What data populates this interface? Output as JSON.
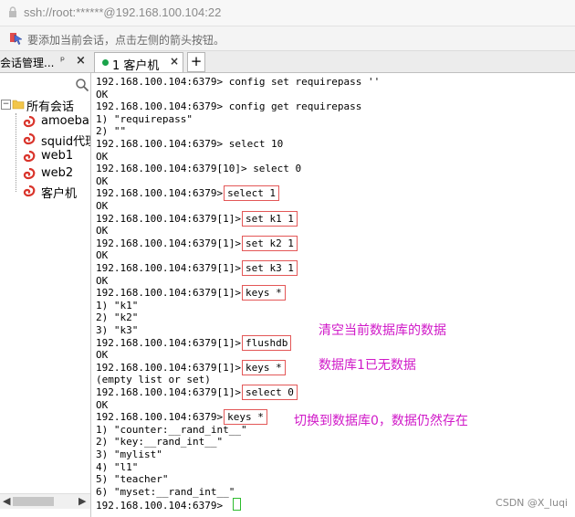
{
  "window": {
    "title": "ssh://root:******@192.168.100.104:22",
    "hint": "要添加当前会话，点击左侧的箭头按钮。"
  },
  "session_panel": {
    "title": "会话管理...",
    "pin_icon": "pin-icon",
    "close_icon": "close-icon",
    "root": "所有会话",
    "items": [
      "amoeba",
      "squid代理",
      "web1",
      "web2",
      "客户机"
    ]
  },
  "tabs": [
    {
      "label": "1 客户机",
      "status_color": "#19a34a"
    }
  ],
  "add_tab_label": "+",
  "terminal": {
    "lines": [
      {
        "prompt": "192.168.100.104:6379> ",
        "cmd": "config set requirepass ''",
        "boxed": false
      },
      {
        "text": "OK"
      },
      {
        "prompt": "192.168.100.104:6379> ",
        "cmd": "config get requirepass",
        "boxed": false
      },
      {
        "text": "1) \"requirepass\""
      },
      {
        "text": "2) \"\""
      },
      {
        "prompt": "192.168.100.104:6379> ",
        "cmd": "select 10",
        "boxed": false
      },
      {
        "text": "OK"
      },
      {
        "prompt": "192.168.100.104:6379[10]> ",
        "cmd": "select 0",
        "boxed": false
      },
      {
        "text": "OK"
      },
      {
        "prompt": "192.168.100.104:6379>",
        "cmd": "select 1",
        "boxed": true
      },
      {
        "text": "OK"
      },
      {
        "prompt": "192.168.100.104:6379[1]>",
        "cmd": "set k1 1",
        "boxed": true
      },
      {
        "text": "OK"
      },
      {
        "prompt": "192.168.100.104:6379[1]>",
        "cmd": "set k2 1",
        "boxed": true
      },
      {
        "text": "OK"
      },
      {
        "prompt": "192.168.100.104:6379[1]>",
        "cmd": "set k3 1",
        "boxed": true
      },
      {
        "text": "OK"
      },
      {
        "prompt": "192.168.100.104:6379[1]>",
        "cmd": "keys *",
        "boxed": true
      },
      {
        "text": "1) \"k1\""
      },
      {
        "text": "2) \"k2\""
      },
      {
        "text": "3) \"k3\""
      },
      {
        "prompt": "192.168.100.104:6379[1]>",
        "cmd": "flushdb",
        "boxed": true
      },
      {
        "text": "OK"
      },
      {
        "prompt": "192.168.100.104:6379[1]>",
        "cmd": "keys *",
        "boxed": true
      },
      {
        "text": "(empty list or set)"
      },
      {
        "prompt": "192.168.100.104:6379[1]>",
        "cmd": "select 0",
        "boxed": true
      },
      {
        "text": "OK"
      },
      {
        "prompt": "192.168.100.104:6379>",
        "cmd": "keys *",
        "boxed": true
      },
      {
        "text": "1) \"counter:__rand_int__\""
      },
      {
        "text": "2) \"key:__rand_int__\""
      },
      {
        "text": "3) \"mylist\""
      },
      {
        "text": "4) \"l1\""
      },
      {
        "text": "5) \"teacher\""
      },
      {
        "text": "6) \"myset:__rand_int__\""
      },
      {
        "prompt": "192.168.100.104:6379> ",
        "cmd": "",
        "boxed": false,
        "cursor": true
      }
    ]
  },
  "annotations": [
    {
      "text": "清空当前数据库的数据",
      "color": "#d01ac8"
    },
    {
      "text": "数据库1已无数据",
      "color": "#d01ac8"
    },
    {
      "text": "切换到数据库0，数据仍然存在",
      "color": "#d01ac8"
    }
  ],
  "watermark": "CSDN @X_luqi"
}
